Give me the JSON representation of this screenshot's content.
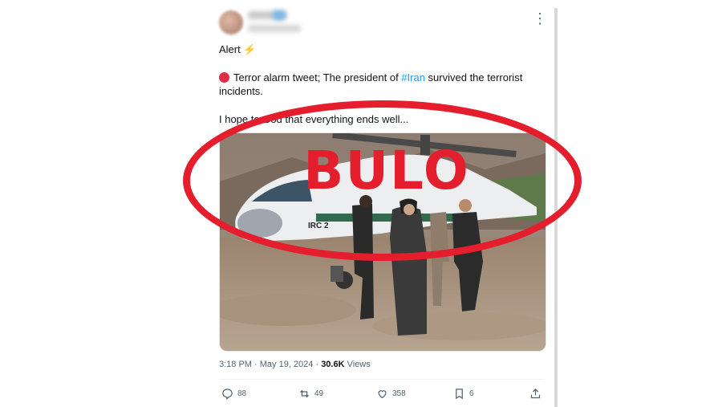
{
  "tweet": {
    "line1": "Alert",
    "line2_pre": "Terror alarm tweet; The president of ",
    "hashtag": "#Iran",
    "line2_post": " survived the terrorist incidents.",
    "line3": "I hope to God that everything ends well...",
    "image_caption": "IRC 2",
    "time": "3:18 PM",
    "date": "May 19, 2024",
    "views_count": "30.6K",
    "views_label": "Views"
  },
  "actions": {
    "replies": "88",
    "reposts": "49",
    "likes": "358",
    "bookmarks": "6"
  },
  "stamp": {
    "text": "BULO",
    "color": "#e51e2d"
  },
  "icons": {
    "alert": "lightning-icon",
    "status": "red-circle-icon",
    "more": "more-horizontal-icon",
    "reply": "reply-icon",
    "repost": "repost-icon",
    "like": "heart-icon",
    "bookmark": "bookmark-icon",
    "share": "share-icon"
  }
}
